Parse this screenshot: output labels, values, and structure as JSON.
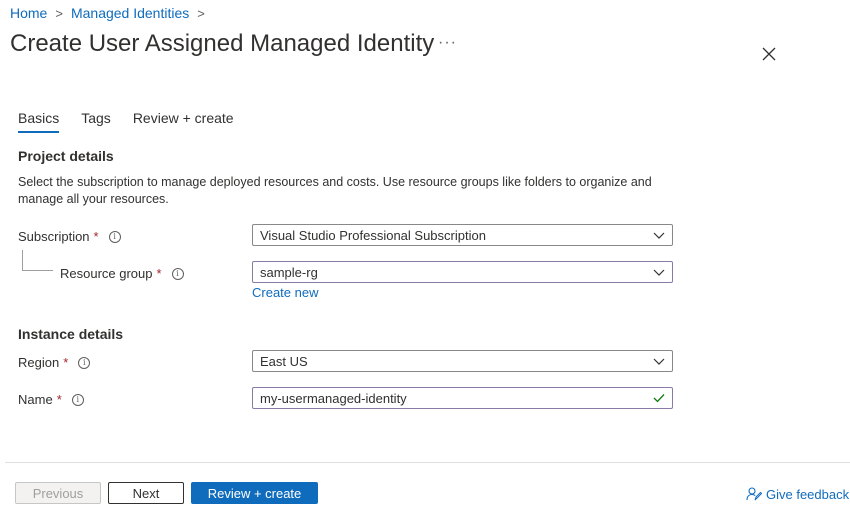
{
  "breadcrumb": {
    "home": "Home",
    "managed_identities": "Managed Identities",
    "sep": ">"
  },
  "header": {
    "title": "Create User Assigned Managed Identity",
    "more": "···"
  },
  "tabs": [
    {
      "label": "Basics",
      "active": true
    },
    {
      "label": "Tags",
      "active": false
    },
    {
      "label": "Review + create",
      "active": false
    }
  ],
  "project": {
    "heading": "Project details",
    "description": "Select the subscription to manage deployed resources and costs. Use resource groups like folders to organize and manage all your resources.",
    "subscription_label": "Subscription",
    "subscription_value": "Visual Studio Professional Subscription",
    "resource_group_label": "Resource group",
    "resource_group_value": "sample-rg",
    "create_new": "Create new"
  },
  "instance": {
    "heading": "Instance details",
    "region_label": "Region",
    "region_value": "East US",
    "name_label": "Name",
    "name_value": "my-usermanaged-identity"
  },
  "required_mark": "*",
  "info_mark": "i",
  "footer": {
    "previous": "Previous",
    "next": "Next",
    "review_create": "Review + create",
    "feedback": "Give feedback"
  },
  "colors": {
    "accent": "#0f6cbd",
    "required": "#a4262c",
    "success": "#107c10"
  }
}
